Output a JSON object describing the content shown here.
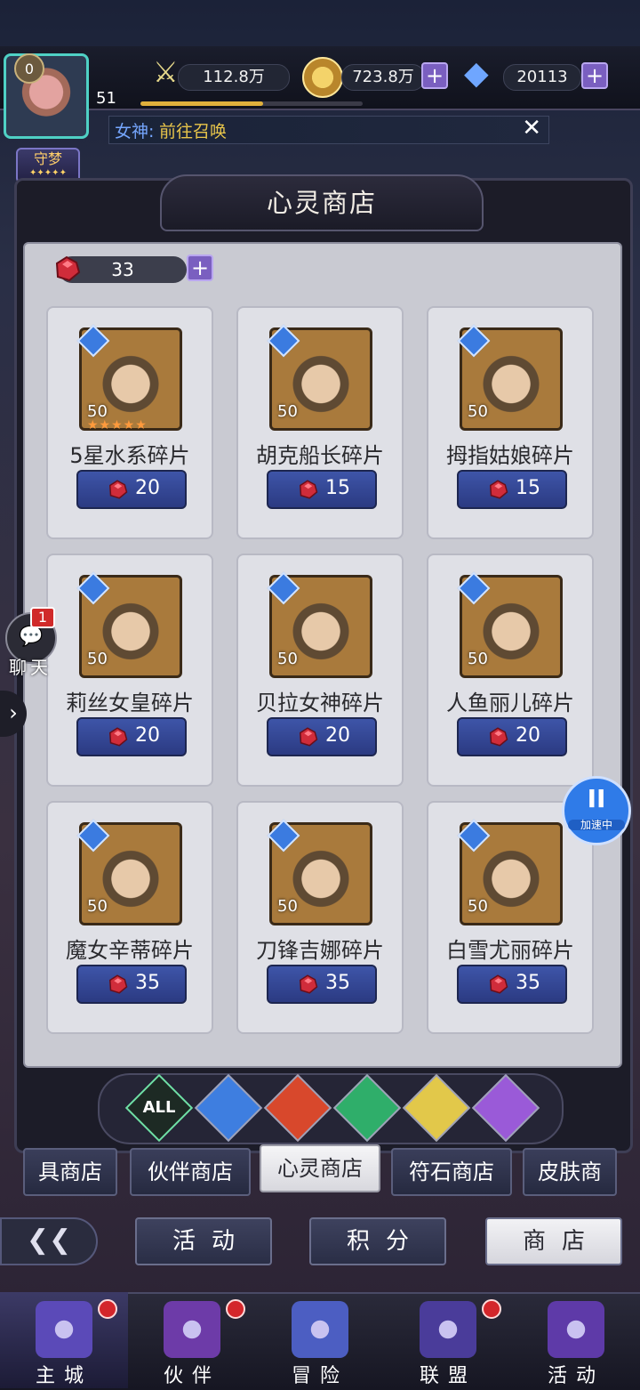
{
  "player": {
    "vip": "0",
    "level": "51",
    "level_progress": 0.55,
    "title_badge": "守梦",
    "title_stars": "✦✦✦✦✦"
  },
  "resources": {
    "power": "112.8万",
    "gold": "723.8万",
    "diamonds": "20113"
  },
  "notice": {
    "prefix": "女神:",
    "link": "前往召唤",
    "close": "✕"
  },
  "shop": {
    "title": "心灵商店",
    "fragment_count": "33",
    "items": [
      {
        "name": "5星水系碎片",
        "level": "50",
        "stars": "★★★★★",
        "price": "20",
        "element": "water"
      },
      {
        "name": "胡克船长碎片",
        "level": "50",
        "stars": "",
        "price": "15",
        "element": "water"
      },
      {
        "name": "拇指姑娘碎片",
        "level": "50",
        "stars": "",
        "price": "15",
        "element": "water"
      },
      {
        "name": "莉丝女皇碎片",
        "level": "50",
        "stars": "",
        "price": "20",
        "element": "water"
      },
      {
        "name": "贝拉女神碎片",
        "level": "50",
        "stars": "",
        "price": "20",
        "element": "water"
      },
      {
        "name": "人鱼丽儿碎片",
        "level": "50",
        "stars": "",
        "price": "20",
        "element": "water"
      },
      {
        "name": "魔女辛蒂碎片",
        "level": "50",
        "stars": "",
        "price": "35",
        "element": "water"
      },
      {
        "name": "刀锋吉娜碎片",
        "level": "50",
        "stars": "",
        "price": "35",
        "element": "water"
      },
      {
        "name": "白雪尤丽碎片",
        "level": "50",
        "stars": "",
        "price": "35",
        "element": "water"
      }
    ]
  },
  "element_tabs": [
    {
      "label": "ALL",
      "color": "#3aa86a"
    },
    {
      "label": "",
      "color": "#3e7ee0"
    },
    {
      "label": "",
      "color": "#d8482c"
    },
    {
      "label": "",
      "color": "#2fae6a"
    },
    {
      "label": "",
      "color": "#e2c84a"
    },
    {
      "label": "",
      "color": "#9a5ad8"
    }
  ],
  "shop_tabs": [
    "具商店",
    "伙伴商店",
    "心灵商店",
    "符石商店",
    "皮肤商"
  ],
  "sub_tabs": [
    "活动",
    "积分",
    "商店"
  ],
  "chat": {
    "label": "聊天",
    "badge": "1"
  },
  "speed": {
    "label": "加速中"
  },
  "nav": [
    "主城",
    "伙伴",
    "冒险",
    "联盟",
    "活动"
  ]
}
